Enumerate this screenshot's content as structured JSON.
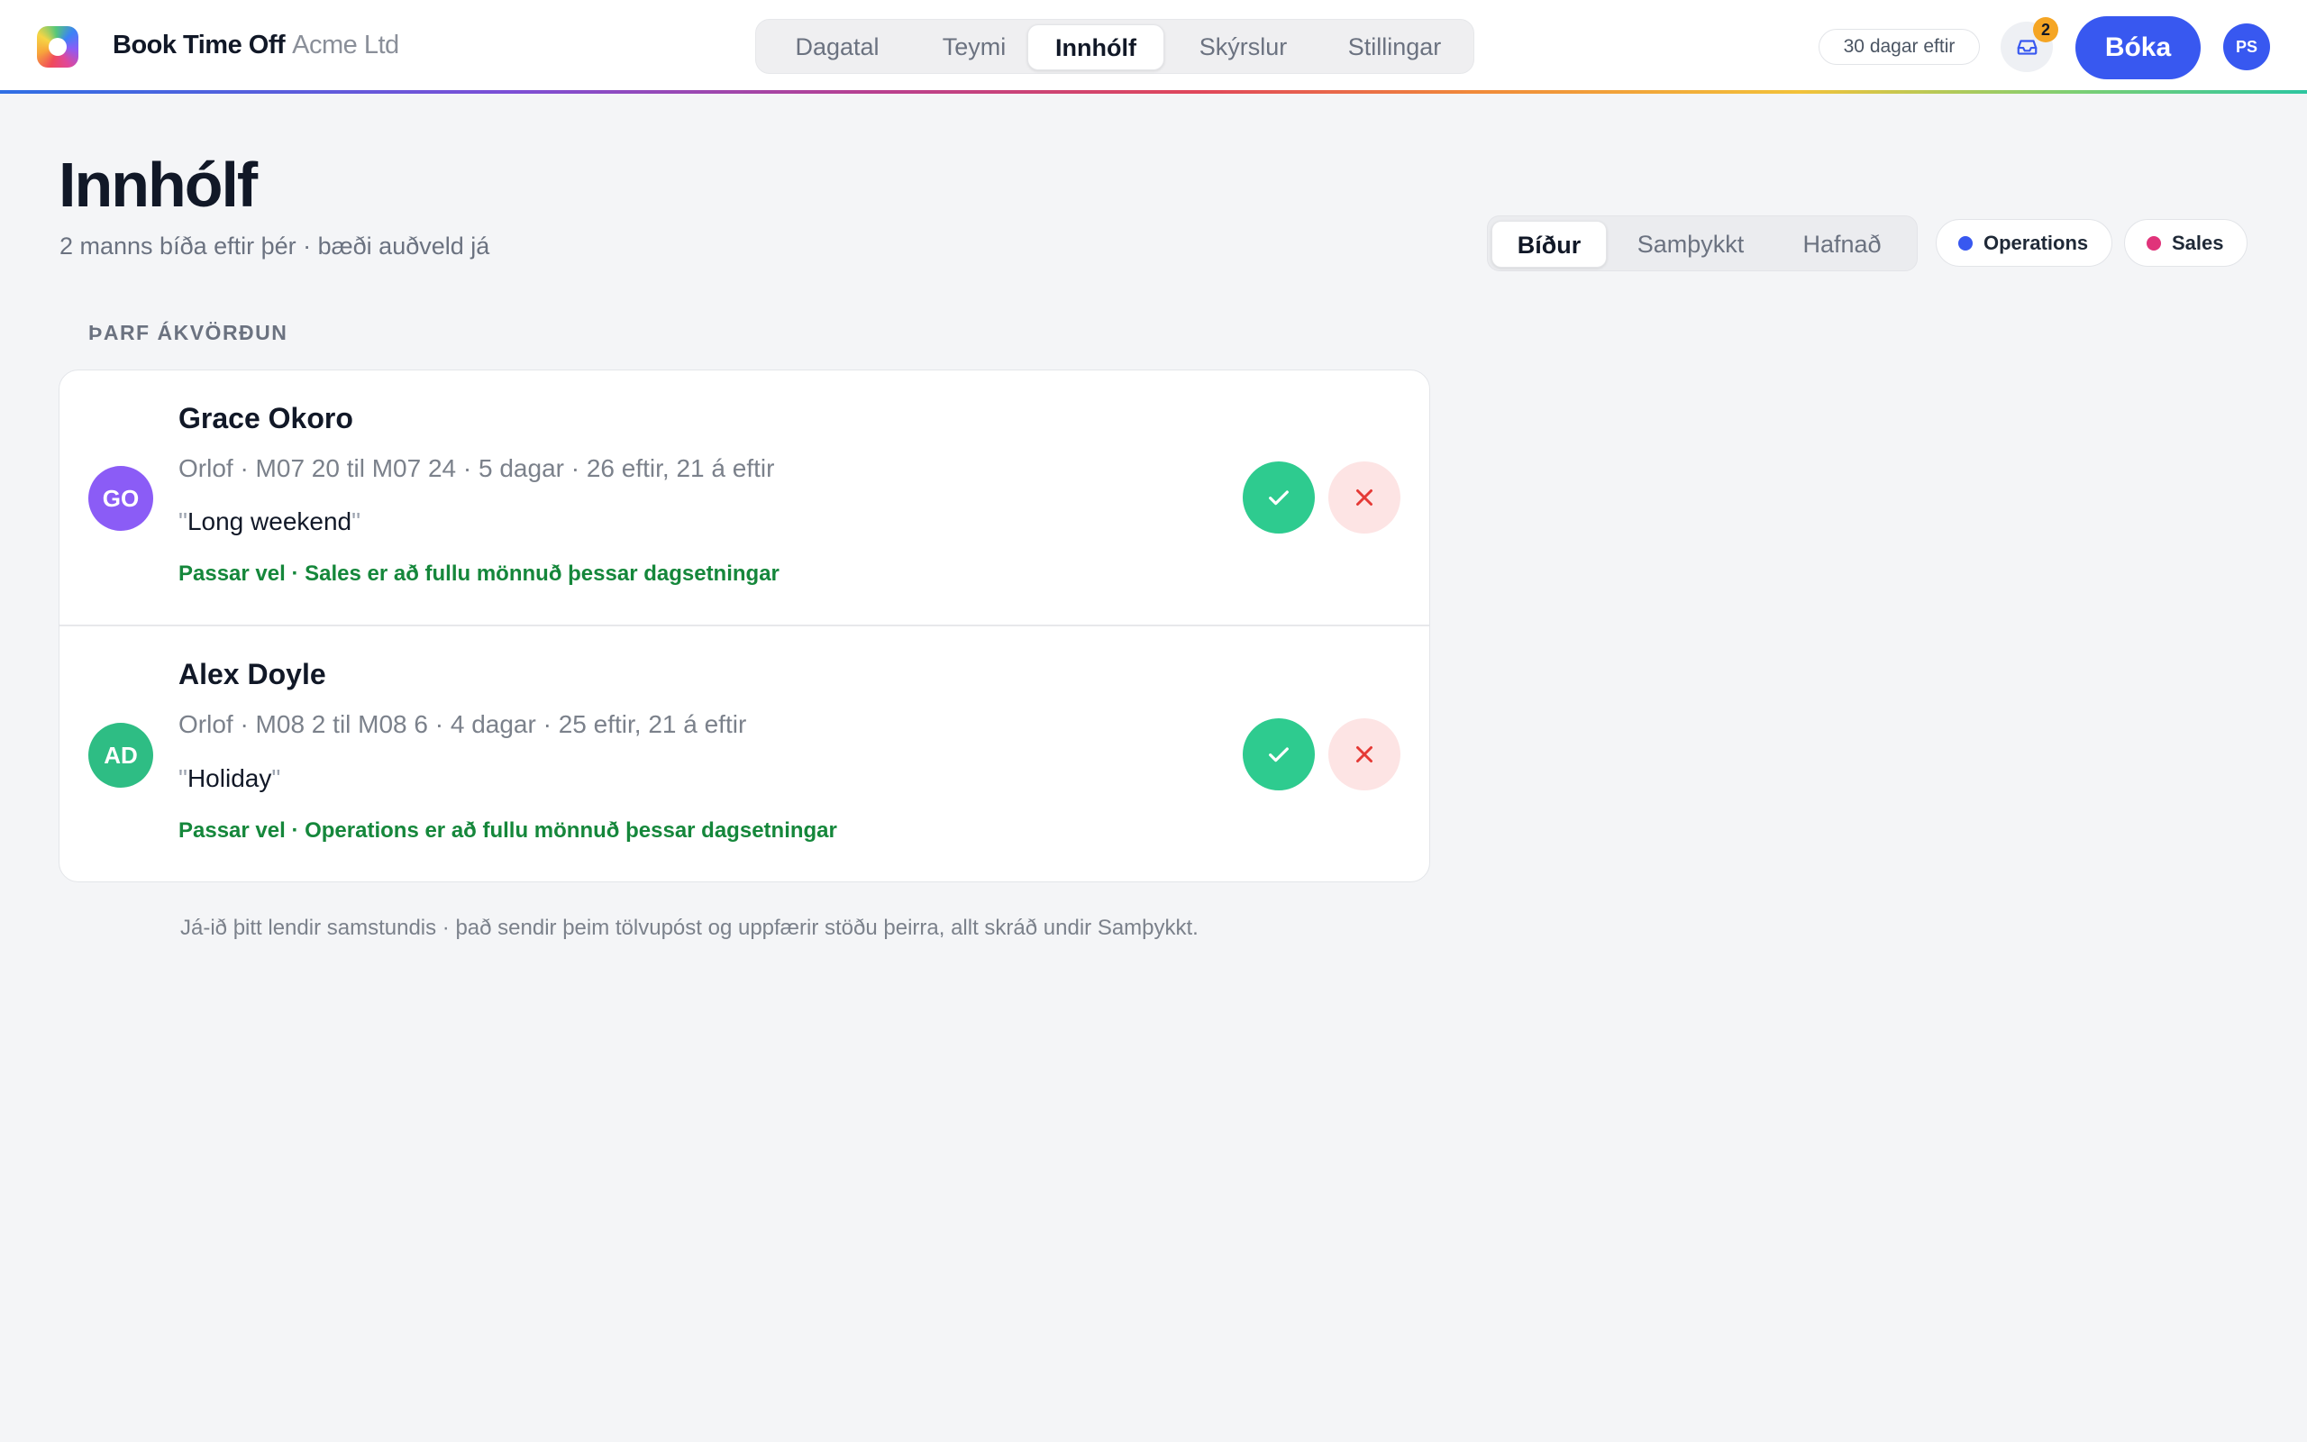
{
  "app": {
    "name": "Book Time Off",
    "org": "Acme Ltd"
  },
  "nav": {
    "tabs": [
      {
        "label": "Dagatal",
        "active": false
      },
      {
        "label": "Teymi",
        "active": false
      },
      {
        "label": "Innhólf",
        "active": true
      },
      {
        "label": "Skýrslur",
        "active": false
      },
      {
        "label": "Stillingar",
        "active": false
      }
    ]
  },
  "header_right": {
    "days_left": "30 dagar eftir",
    "inbox_icon": "inbox-icon",
    "inbox_count": "2",
    "book_label": "Bóka",
    "user_initials": "PS"
  },
  "page": {
    "title": "Innhólf",
    "subtitle": "2 manns bíða eftir þér · bæði auðveld já"
  },
  "status_filter": {
    "tabs": [
      {
        "label": "Bíður",
        "active": true
      },
      {
        "label": "Samþykkt",
        "active": false
      },
      {
        "label": "Hafnað",
        "active": false
      }
    ]
  },
  "team_filters": [
    {
      "label": "Operations",
      "color": "#3858f0"
    },
    {
      "label": "Sales",
      "color": "#e0337a"
    }
  ],
  "section": {
    "label": "ÞARF ÁKVÖRÐUN"
  },
  "requests": [
    {
      "initials": "GO",
      "avatar_color": "#8b5cf6",
      "name": "Grace Okoro",
      "meta": "Orlof · M07 20 til M07 24 · 5 dagar · 26 eftir, 21 á eftir",
      "quote": "Long weekend",
      "fit": "Passar vel · Sales er að fullu mönnuð þessar dagsetningar",
      "approve_icon": "check-icon",
      "reject_icon": "x-icon"
    },
    {
      "initials": "AD",
      "avatar_color": "#2ebd84",
      "name": "Alex Doyle",
      "meta": "Orlof · M08 2 til M08 6 · 4 dagar · 25 eftir, 21 á eftir",
      "quote": "Holiday",
      "fit": "Passar vel · Operations er að fullu mönnuð þessar dagsetningar",
      "approve_icon": "check-icon",
      "reject_icon": "x-icon"
    }
  ],
  "footnote": "Já-ið þitt lendir samstundis · það sendir þeim tölvupóst og uppfærir stöðu þeirra, allt skráð undir Samþykkt."
}
